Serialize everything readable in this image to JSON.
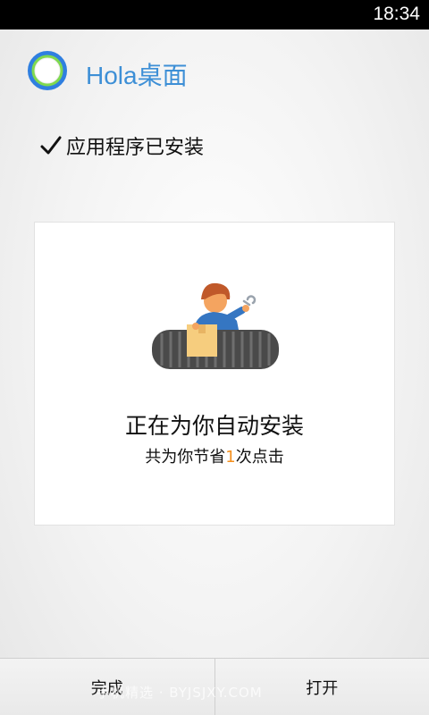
{
  "status_bar": {
    "time": "18:34"
  },
  "header": {
    "app_name": "Hola桌面",
    "app_icon": "hola-ring-icon"
  },
  "install_status": {
    "text": "应用程序已安装",
    "icon": "checkmark-icon"
  },
  "card": {
    "illustration": "worker-conveyor-illustration",
    "title": "正在为你自动安装",
    "subtitle_prefix": "共为你节省",
    "subtitle_count": "1",
    "subtitle_suffix": "次点击"
  },
  "buttons": {
    "done": "完成",
    "open": "打开"
  },
  "watermark": "手机精选 · BYJSJXY.COM",
  "colors": {
    "accent_blue": "#3d8fd6",
    "count_orange": "#f5901e",
    "status_bar": "#000000"
  }
}
